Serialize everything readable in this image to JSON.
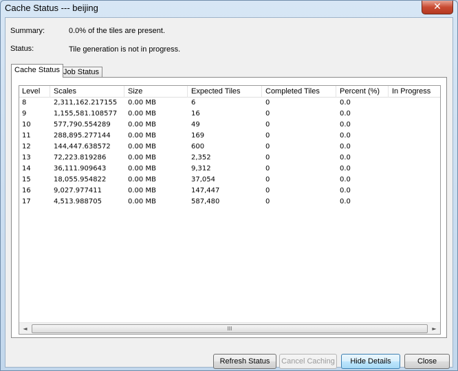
{
  "window": {
    "title": "Cache Status --- beijing",
    "close_glyph": "✕"
  },
  "summary": {
    "label": "Summary:",
    "value": "0.0% of the tiles are present."
  },
  "status": {
    "label": "Status:",
    "value": "Tile generation is not in progress."
  },
  "tabs": [
    {
      "label": "Cache Status",
      "active": true
    },
    {
      "label": "Job Status",
      "active": false
    }
  ],
  "table": {
    "columns": [
      "Level",
      "Scales",
      "Size",
      "Expected Tiles",
      "Completed Tiles",
      "Percent (%)",
      "In Progress"
    ],
    "rows": [
      [
        "8",
        "2,311,162.217155",
        "0.00 MB",
        "6",
        "0",
        "0.0",
        ""
      ],
      [
        "9",
        "1,155,581.108577",
        "0.00 MB",
        "16",
        "0",
        "0.0",
        ""
      ],
      [
        "10",
        "577,790.554289",
        "0.00 MB",
        "49",
        "0",
        "0.0",
        ""
      ],
      [
        "11",
        "288,895.277144",
        "0.00 MB",
        "169",
        "0",
        "0.0",
        ""
      ],
      [
        "12",
        "144,447.638572",
        "0.00 MB",
        "600",
        "0",
        "0.0",
        ""
      ],
      [
        "13",
        "72,223.819286",
        "0.00 MB",
        "2,352",
        "0",
        "0.0",
        ""
      ],
      [
        "14",
        "36,111.909643",
        "0.00 MB",
        "9,312",
        "0",
        "0.0",
        ""
      ],
      [
        "15",
        "18,055.954822",
        "0.00 MB",
        "37,054",
        "0",
        "0.0",
        ""
      ],
      [
        "16",
        "9,027.977411",
        "0.00 MB",
        "147,447",
        "0",
        "0.0",
        ""
      ],
      [
        "17",
        "4,513.988705",
        "0.00 MB",
        "587,480",
        "0",
        "0.0",
        ""
      ]
    ]
  },
  "scrollbar": {
    "left_arrow": "◄",
    "right_arrow": "►",
    "grip": "III"
  },
  "buttons": {
    "refresh": "Refresh Status",
    "cancel": "Cancel Caching",
    "hide": "Hide Details",
    "close": "Close"
  }
}
